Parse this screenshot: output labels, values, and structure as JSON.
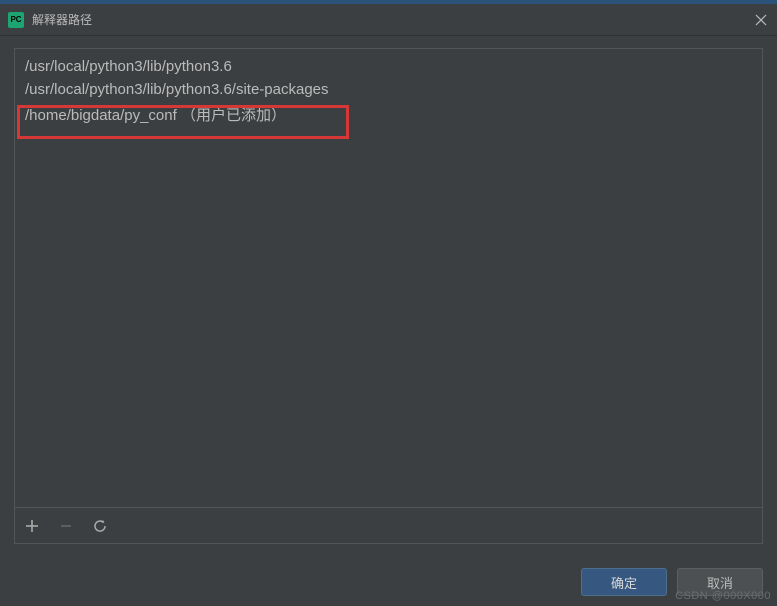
{
  "titlebar": {
    "title": "解释器路径"
  },
  "paths": {
    "item0": "/usr/local/python3/lib/python3.6",
    "item1": "/usr/local/python3/lib/python3.6/site-packages",
    "item2": "/home/bigdata/py_conf   （用户已添加）"
  },
  "buttons": {
    "ok": "确定",
    "cancel": "取消"
  },
  "watermark": "CSDN @000X000"
}
